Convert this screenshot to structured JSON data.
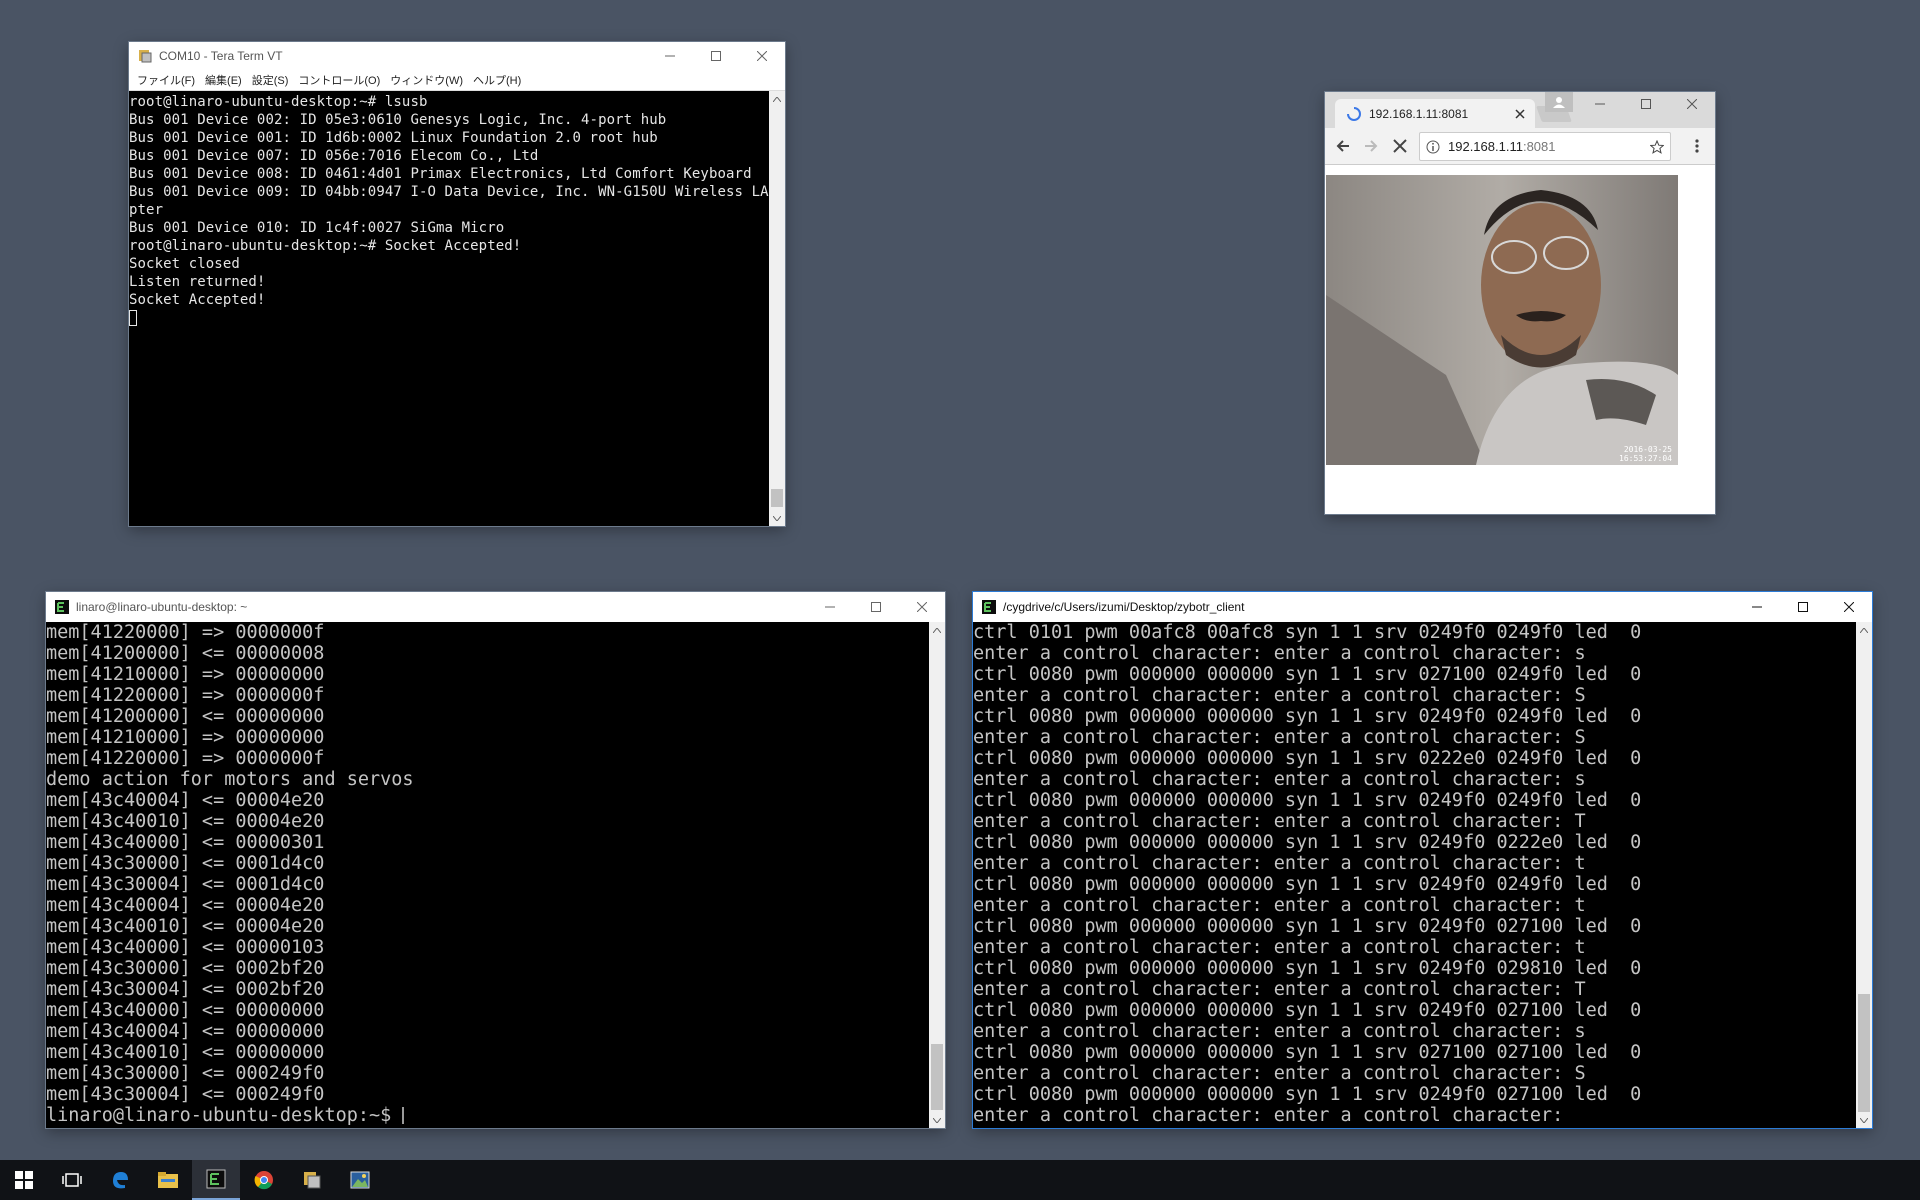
{
  "teraterm": {
    "title": "COM10 - Tera Term VT",
    "menu": [
      "ファイル(F)",
      "編集(E)",
      "設定(S)",
      "コントロール(O)",
      "ウィンドウ(W)",
      "ヘルプ(H)"
    ],
    "lines": [
      "root@linaro-ubuntu-desktop:~# lsusb",
      "Bus 001 Device 002: ID 05e3:0610 Genesys Logic, Inc. 4-port hub",
      "Bus 001 Device 001: ID 1d6b:0002 Linux Foundation 2.0 root hub",
      "Bus 001 Device 007: ID 056e:7016 Elecom Co., Ltd",
      "Bus 001 Device 008: ID 0461:4d01 Primax Electronics, Ltd Comfort Keyboard",
      "Bus 001 Device 009: ID 04bb:0947 I-O Data Device, Inc. WN-G150U Wireless LAN Ada",
      "pter",
      "Bus 001 Device 010: ID 1c4f:0027 SiGma Micro",
      "root@linaro-ubuntu-desktop:~# Socket Accepted!",
      "Socket closed",
      "Listen returned!",
      "Socket Accepted!"
    ]
  },
  "browser": {
    "tab_title": "192.168.1.11:8081",
    "url_host": "192.168.1.11",
    "url_port": ":8081",
    "stamp_line1": "2016-03-25",
    "stamp_line2": "16:53:27:04"
  },
  "linaro": {
    "title": "linaro@linaro-ubuntu-desktop: ~",
    "lines": [
      "mem[41220000] => 0000000f",
      "mem[41200000] <= 00000008",
      "mem[41210000] => 00000000",
      "mem[41220000] => 0000000f",
      "mem[41200000] <= 00000000",
      "mem[41210000] => 00000000",
      "mem[41220000] => 0000000f",
      "demo action for motors and servos",
      "mem[43c40004] <= 00004e20",
      "mem[43c40010] <= 00004e20",
      "mem[43c40000] <= 00000301",
      "mem[43c30000] <= 0001d4c0",
      "mem[43c30004] <= 0001d4c0",
      "mem[43c40004] <= 00004e20",
      "mem[43c40010] <= 00004e20",
      "mem[43c40000] <= 00000103",
      "mem[43c30000] <= 0002bf20",
      "mem[43c30004] <= 0002bf20",
      "mem[43c40000] <= 00000000",
      "mem[43c40004] <= 00000000",
      "mem[43c40010] <= 00000000",
      "mem[43c30000] <= 000249f0",
      "mem[43c30004] <= 000249f0",
      "linaro@linaro-ubuntu-desktop:~$ "
    ]
  },
  "cygwin": {
    "title": "/cygdrive/c/Users/izumi/Desktop/zybotr_client",
    "lines": [
      "ctrl 0101 pwm 00afc8 00afc8 syn 1 1 srv 0249f0 0249f0 led  0",
      "enter a control character: enter a control character: s",
      "ctrl 0080 pwm 000000 000000 syn 1 1 srv 027100 0249f0 led  0",
      "enter a control character: enter a control character: S",
      "ctrl 0080 pwm 000000 000000 syn 1 1 srv 0249f0 0249f0 led  0",
      "enter a control character: enter a control character: S",
      "ctrl 0080 pwm 000000 000000 syn 1 1 srv 0222e0 0249f0 led  0",
      "enter a control character: enter a control character: s",
      "ctrl 0080 pwm 000000 000000 syn 1 1 srv 0249f0 0249f0 led  0",
      "enter a control character: enter a control character: T",
      "ctrl 0080 pwm 000000 000000 syn 1 1 srv 0249f0 0222e0 led  0",
      "enter a control character: enter a control character: t",
      "ctrl 0080 pwm 000000 000000 syn 1 1 srv 0249f0 0249f0 led  0",
      "enter a control character: enter a control character: t",
      "ctrl 0080 pwm 000000 000000 syn 1 1 srv 0249f0 027100 led  0",
      "enter a control character: enter a control character: t",
      "ctrl 0080 pwm 000000 000000 syn 1 1 srv 0249f0 029810 led  0",
      "enter a control character: enter a control character: T",
      "ctrl 0080 pwm 000000 000000 syn 1 1 srv 0249f0 027100 led  0",
      "enter a control character: enter a control character: s",
      "ctrl 0080 pwm 000000 000000 syn 1 1 srv 027100 027100 led  0",
      "enter a control character: enter a control character: S",
      "ctrl 0080 pwm 000000 000000 syn 1 1 srv 0249f0 027100 led  0",
      "enter a control character: enter a control character: "
    ]
  },
  "taskbar": {
    "icons": [
      "windows-start-icon",
      "task-view-icon",
      "edge-icon",
      "file-explorer-icon",
      "cygwin-terminal-icon",
      "chrome-icon",
      "teraterm-icon",
      "photos-icon"
    ]
  },
  "colors": {
    "desktop": "#4a5464",
    "taskbar": "#101216",
    "terminal_bg": "#000000",
    "active_border": "#2b7bd6"
  }
}
